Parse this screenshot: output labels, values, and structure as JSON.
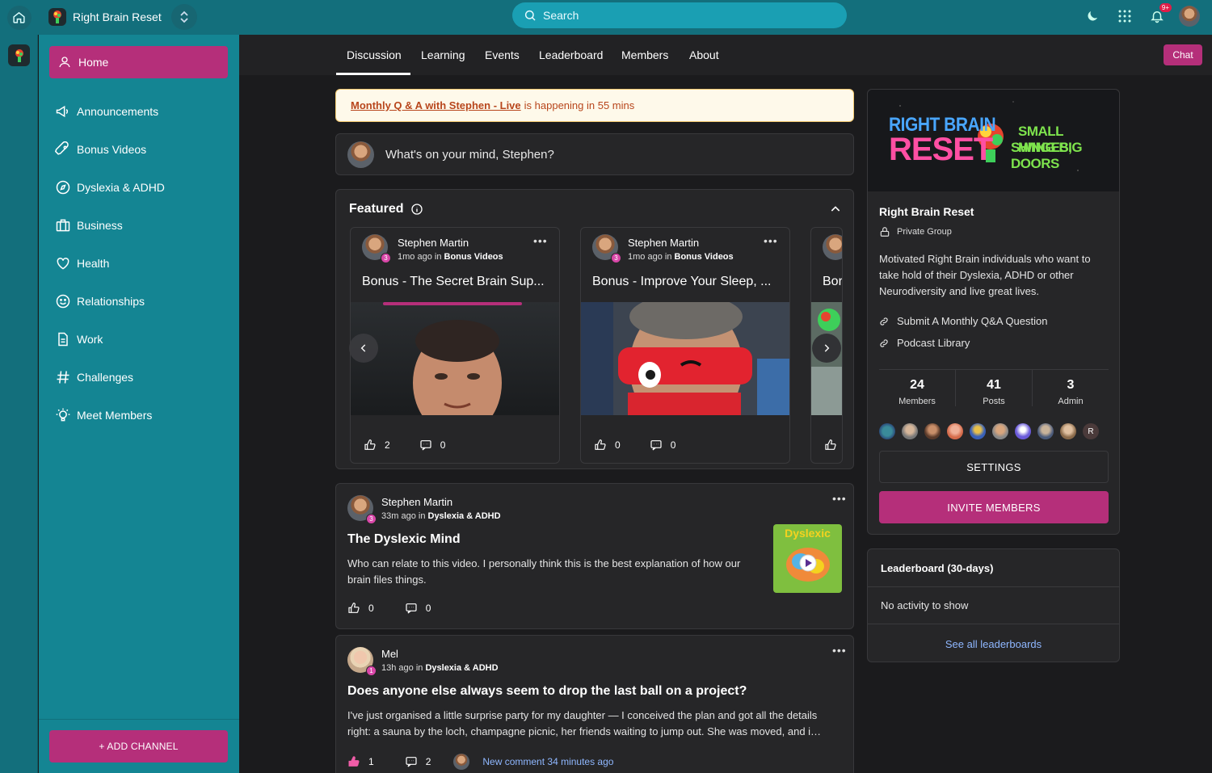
{
  "app": {
    "group_name": "Right Brain Reset"
  },
  "search": {
    "placeholder": "Search"
  },
  "notifications": {
    "badge": "9+"
  },
  "sidebar": {
    "items": [
      {
        "label": "Home",
        "icon": "user-icon"
      },
      {
        "label": "Announcements",
        "icon": "megaphone-icon"
      },
      {
        "label": "Bonus Videos",
        "icon": "rocket-icon"
      },
      {
        "label": "Dyslexia & ADHD",
        "icon": "compass-icon"
      },
      {
        "label": "Business",
        "icon": "briefcase-icon"
      },
      {
        "label": "Health",
        "icon": "heart-icon"
      },
      {
        "label": "Relationships",
        "icon": "smile-icon"
      },
      {
        "label": "Work",
        "icon": "document-icon"
      },
      {
        "label": "Challenges",
        "icon": "hashtag-icon"
      },
      {
        "label": "Meet Members",
        "icon": "lightbulb-icon"
      }
    ],
    "add_channel": "+ ADD CHANNEL"
  },
  "tabs": [
    "Discussion",
    "Learning",
    "Events",
    "Leaderboard",
    "Members",
    "About"
  ],
  "chat_label": "Chat",
  "banner": {
    "link": "Monthly Q & A with Stephen - Live",
    "text": "is happening in 55 mins"
  },
  "composer": {
    "placeholder": "What's on your mind, Stephen?"
  },
  "featured": {
    "title": "Featured",
    "cards": [
      {
        "author": "Stephen Martin",
        "time": "1mo ago",
        "in": "in",
        "channel": "Bonus Videos",
        "title": "Bonus - The Secret Brain Sup...",
        "likes": "2",
        "comments": "0",
        "level": "3"
      },
      {
        "author": "Stephen Martin",
        "time": "1mo ago",
        "in": "in",
        "channel": "Bonus Videos",
        "title": "Bonus - Improve Your Sleep, ...",
        "likes": "0",
        "comments": "0",
        "level": "3"
      },
      {
        "title": "Bor"
      }
    ]
  },
  "posts": [
    {
      "author": "Stephen Martin",
      "time": "33m ago",
      "in": "in",
      "channel": "Dyslexia & ADHD",
      "title": "The Dyslexic Mind",
      "body": "Who can relate to this video. I personally think this is the best explanation of how our brain files things.",
      "likes": "0",
      "comments": "0",
      "level": "3",
      "thumb_text": "Dyslexic"
    },
    {
      "author": "Mel",
      "time": "13h ago",
      "in": "in",
      "channel": "Dyslexia & ADHD",
      "title": "Does anyone else always seem to drop the last ball on a project?",
      "body": "I've just organised a little surprise party for my daughter — I conceived the plan and got all the details right: a sauna by the loch, champagne picnic, her friends waiting to jump out. She was moved, and i…",
      "likes": "1",
      "comments": "2",
      "level": "1",
      "new_comment": "New comment 34 minutes ago"
    }
  ],
  "about": {
    "hero": {
      "line1": "RIGHT BRAIN",
      "line2": "RESET",
      "tag1": "SMALL HINGES,",
      "tag2": "SWING BIG DOORS"
    },
    "name": "Right Brain Reset",
    "privacy": "Private Group",
    "description": "Motivated Right Brain individuals who want to take hold of their Dyslexia, ADHD or other Neurodiversity and live great lives.",
    "links": [
      "Submit A Monthly Q&A Question",
      "Podcast Library"
    ],
    "stats": [
      {
        "value": "24",
        "label": "Members"
      },
      {
        "value": "41",
        "label": "Posts"
      },
      {
        "value": "3",
        "label": "Admin"
      }
    ],
    "member_initial": "R",
    "settings": "SETTINGS",
    "invite": "INVITE MEMBERS"
  },
  "leaderboard": {
    "title": "Leaderboard (30-days)",
    "empty": "No activity to show",
    "see_all": "See all leaderboards"
  },
  "colors": {
    "teal_bar": "#136f7c",
    "sidebar": "#148593",
    "accent": "#b52f7a",
    "search": "#1a9fb3"
  }
}
